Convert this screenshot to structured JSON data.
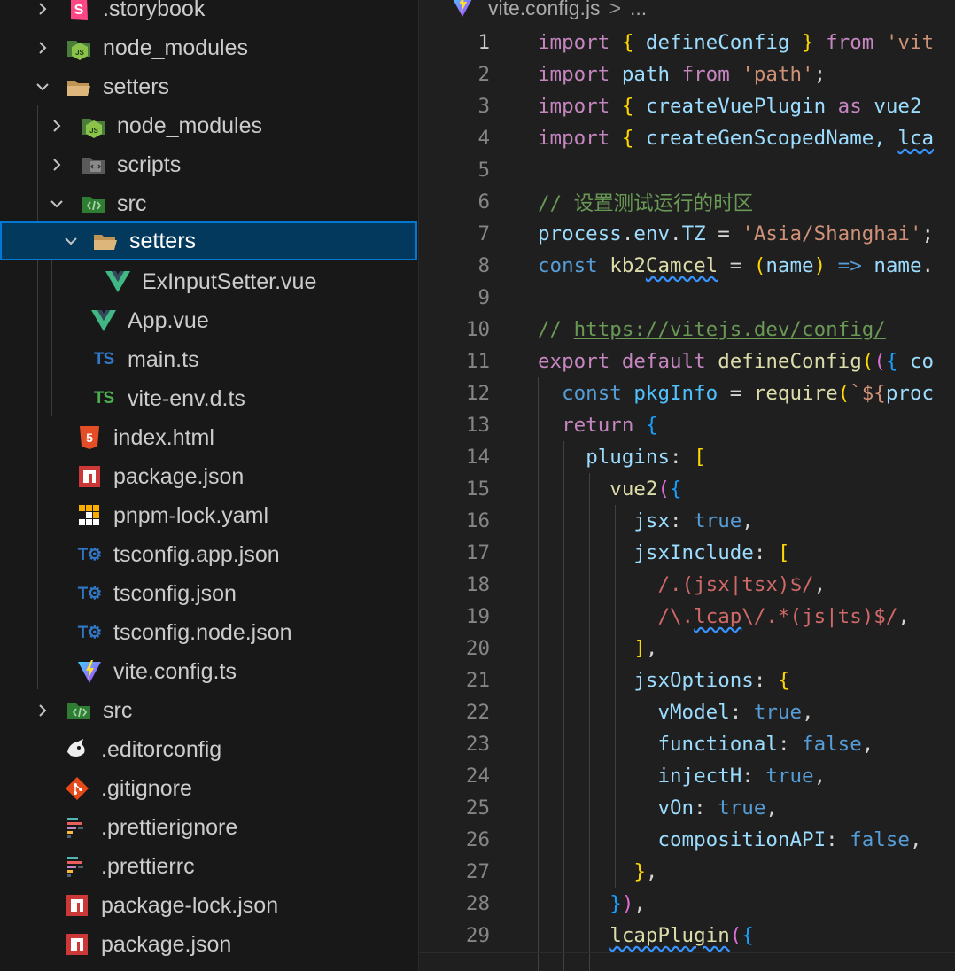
{
  "explorer": {
    "items": [
      {
        "label": ".storybook",
        "icon": "storybook-icon",
        "chevron": "right"
      },
      {
        "label": "node_modules",
        "icon": "node-folder-icon",
        "chevron": "right"
      },
      {
        "label": "setters",
        "icon": "folder-open-icon",
        "chevron": "down"
      },
      {
        "label": "node_modules",
        "icon": "node-folder-icon",
        "chevron": "right"
      },
      {
        "label": "scripts",
        "icon": "scripts-folder-icon",
        "chevron": "right"
      },
      {
        "label": "src",
        "icon": "src-folder-icon",
        "chevron": "down"
      },
      {
        "label": "setters",
        "icon": "folder-open-icon",
        "chevron": "down"
      },
      {
        "label": "ExInputSetter.vue",
        "icon": "vue-icon",
        "chevron": ""
      },
      {
        "label": "App.vue",
        "icon": "vue-icon",
        "chevron": ""
      },
      {
        "label": "main.ts",
        "icon": "ts-icon",
        "chevron": ""
      },
      {
        "label": "vite-env.d.ts",
        "icon": "ts-def-icon",
        "chevron": ""
      },
      {
        "label": "index.html",
        "icon": "html5-icon",
        "chevron": ""
      },
      {
        "label": "package.json",
        "icon": "npm-icon",
        "chevron": ""
      },
      {
        "label": "pnpm-lock.yaml",
        "icon": "pnpm-icon",
        "chevron": ""
      },
      {
        "label": "tsconfig.app.json",
        "icon": "tsconfig-icon",
        "chevron": ""
      },
      {
        "label": "tsconfig.json",
        "icon": "tsconfig-icon",
        "chevron": ""
      },
      {
        "label": "tsconfig.node.json",
        "icon": "tsconfig-icon",
        "chevron": ""
      },
      {
        "label": "vite.config.ts",
        "icon": "vite-icon",
        "chevron": ""
      },
      {
        "label": "src",
        "icon": "src-folder-icon",
        "chevron": "right"
      },
      {
        "label": ".editorconfig",
        "icon": "editorconfig-icon",
        "chevron": ""
      },
      {
        "label": ".gitignore",
        "icon": "git-icon",
        "chevron": ""
      },
      {
        "label": ".prettierignore",
        "icon": "prettier-icon",
        "chevron": ""
      },
      {
        "label": ".prettierrc",
        "icon": "prettier-icon",
        "chevron": ""
      },
      {
        "label": "package-lock.json",
        "icon": "npm-icon",
        "chevron": ""
      },
      {
        "label": "package.json",
        "icon": "npm-icon",
        "chevron": ""
      }
    ],
    "selected_label": "setters"
  },
  "editor": {
    "breadcrumb_file": "vite.config.js",
    "breadcrumb_sep": ">",
    "breadcrumb_more": "...",
    "line_numbers": [
      "1",
      "2",
      "3",
      "4",
      "5",
      "6",
      "7",
      "8",
      "9",
      "10",
      "11",
      "12",
      "13",
      "14",
      "15",
      "16",
      "17",
      "18",
      "19",
      "20",
      "21",
      "22",
      "23",
      "24",
      "25",
      "26",
      "27",
      "28",
      "29"
    ],
    "active_line": "1",
    "code": {
      "l1_import": "import",
      "l1_name": "defineConfig",
      "l1_from": "from",
      "l1_str": "'vit",
      "l2_import": "import",
      "l2_name": "path",
      "l2_from": "from",
      "l2_str": "'path'",
      "l3_import": "import",
      "l3_name": "createVuePlugin",
      "l3_as": "as",
      "l3_alias": "vue2",
      "l4_import": "import",
      "l4_name": "createGenScopedName,",
      "l4_next": "lca",
      "l6_comment": "// 设置测试运行的时区",
      "l7_obj": "process",
      "l7_env": "env",
      "l7_tz": "TZ",
      "l7_str": "'Asia/Shanghai'",
      "l8_const": "const",
      "l8_kb": "kb2",
      "l8_camcel": "Camcel",
      "l8_param": "name",
      "l8_arrow": "=>",
      "l8_name": "name",
      "l10_comment_prefix": "// ",
      "l10_url": "https://vitejs.dev/config/",
      "l11_export": "export",
      "l11_default": "default",
      "l11_fn": "defineConfig",
      "l11_rest": "co",
      "l12_const": "const",
      "l12_var": "pkgInfo",
      "l12_fn": "require",
      "l12_tpl": "`${",
      "l12_proc": "proc",
      "l13_return": "return",
      "l14_key": "plugins",
      "l15_fn": "vue2",
      "l16_key": "jsx",
      "l16_val": "true",
      "l17_key": "jsxInclude",
      "l18_rx": "/.(jsx|tsx)$/",
      "l19_rx_a": "/\\.",
      "l19_rx_b": "lcap",
      "l19_rx_c": "\\/.*(js|ts)$/",
      "l21_key": "jsxOptions",
      "l22_key": "vModel",
      "l22_val": "true",
      "l23_key": "functional",
      "l23_val": "false",
      "l24_key": "injectH",
      "l24_val": "true",
      "l25_key": "vOn",
      "l25_val": "true",
      "l26_key": "compositionAPI",
      "l26_val": "false",
      "l29_fn": "lcapPlugin"
    }
  }
}
